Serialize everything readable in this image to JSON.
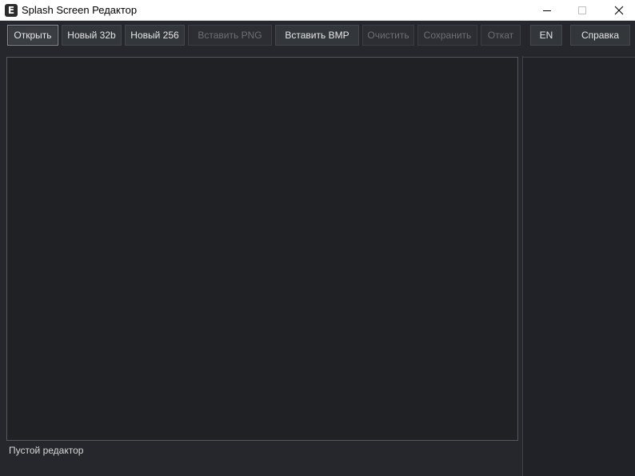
{
  "window": {
    "title": "Splash Screen Редактор",
    "icon_letter": "E",
    "controls": [
      "minimize-icon",
      "maximize-icon",
      "close-icon"
    ]
  },
  "toolbar": {
    "buttons": [
      {
        "label": "Открыть",
        "state": "focused"
      },
      {
        "label": "Новый 32b",
        "state": "enabled"
      },
      {
        "label": "Новый 256",
        "state": "enabled"
      },
      {
        "label": "Вставить PNG",
        "state": "disabled"
      },
      {
        "label": "Вставить BMP",
        "state": "enabled"
      },
      {
        "label": "Очистить",
        "state": "disabled"
      },
      {
        "label": "Сохранить",
        "state": "disabled"
      },
      {
        "label": "Откат",
        "state": "disabled"
      },
      {
        "label": "EN",
        "state": "enabled"
      },
      {
        "label": "Справка",
        "state": "enabled"
      }
    ]
  },
  "status": {
    "text": "Пустой редактор"
  },
  "colors": {
    "background": "#25272c",
    "canvas": "#1f2125",
    "button": "#33363b",
    "text": "#e6e6e6",
    "disabled_text": "#6c6f74"
  }
}
